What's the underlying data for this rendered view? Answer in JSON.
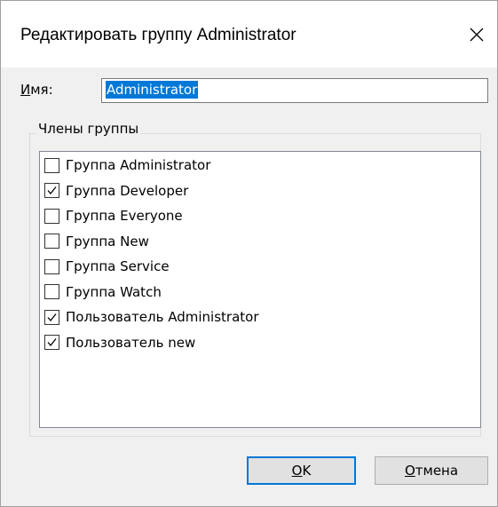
{
  "dialog": {
    "title": "Редактировать группу Administrator"
  },
  "name_field": {
    "label_underlined": "И",
    "label_rest": "мя:",
    "value": "Administrator"
  },
  "members": {
    "legend": "Члены группы",
    "items": [
      {
        "label": "Группа Administrator",
        "checked": false
      },
      {
        "label": "Группа Developer",
        "checked": true
      },
      {
        "label": "Группа Everyone",
        "checked": false
      },
      {
        "label": "Группа New",
        "checked": false
      },
      {
        "label": "Группа Service",
        "checked": false
      },
      {
        "label": "Группа Watch",
        "checked": false
      },
      {
        "label": "Пользователь Administrator",
        "checked": true
      },
      {
        "label": "Пользователь new",
        "checked": true
      }
    ]
  },
  "buttons": {
    "ok_underlined": "O",
    "ok_rest": "K",
    "cancel_underlined": "О",
    "cancel_rest": "тмена"
  },
  "icons": {
    "close": "close-icon",
    "check": "checkmark-icon"
  },
  "colors": {
    "accent": "#0078d7",
    "selection_text": "#ffffff"
  }
}
